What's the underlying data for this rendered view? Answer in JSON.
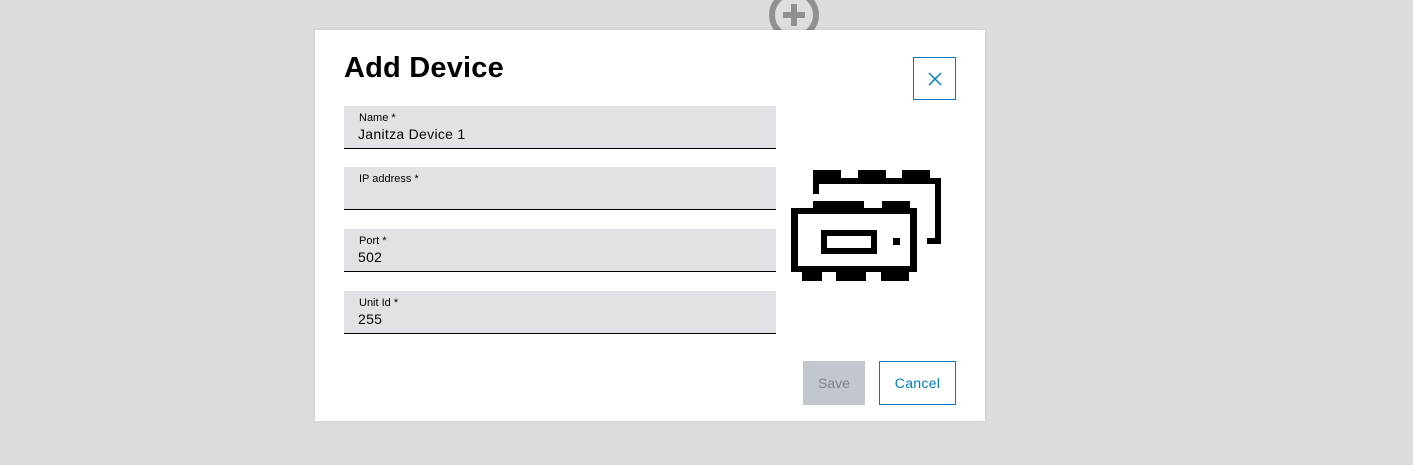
{
  "dialog": {
    "title": "Add Device",
    "fields": [
      {
        "label": "Name *",
        "value": "Janitza Device 1"
      },
      {
        "label": "IP address *",
        "value": ""
      },
      {
        "label": "Port *",
        "value": "502"
      },
      {
        "label": "Unit Id *",
        "value": "255"
      }
    ],
    "save_label": "Save",
    "cancel_label": "Cancel"
  },
  "icons": {
    "background": "add-circle-icon",
    "close": "close-icon",
    "illustration": "devices-icon"
  },
  "colors": {
    "accent": "#007bc0",
    "field_bg": "#e0e2e5",
    "disabled_bg": "#c1c7cc",
    "backdrop": "#dcdddf"
  }
}
